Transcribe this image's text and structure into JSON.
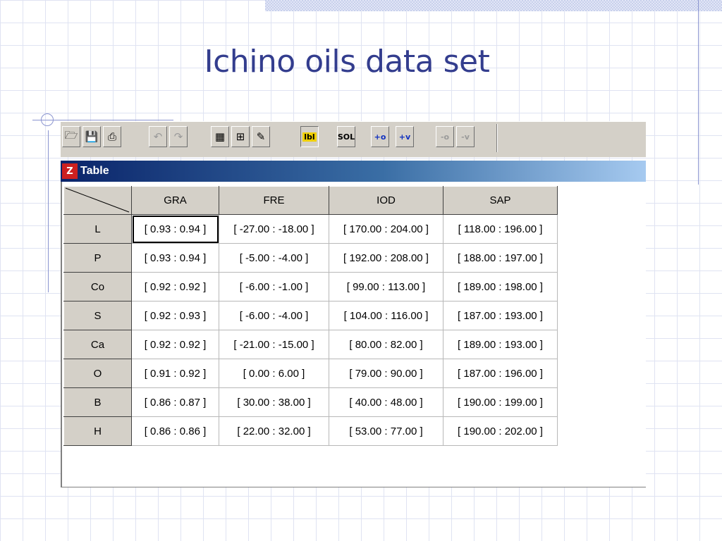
{
  "slide": {
    "title": "Ichino oils data set"
  },
  "toolbar": {
    "buttons": [
      {
        "icon": "open-folder-icon",
        "glyph": "🗁",
        "state": "normal"
      },
      {
        "icon": "save-icon",
        "glyph": "💾",
        "state": "normal"
      },
      {
        "icon": "print-icon",
        "glyph": "⎙",
        "state": "normal"
      },
      {
        "icon": "undo-icon",
        "glyph": "↶",
        "state": "disabled"
      },
      {
        "icon": "redo-icon",
        "glyph": "↷",
        "state": "disabled"
      },
      {
        "icon": "table-icon",
        "glyph": "▦",
        "state": "normal"
      },
      {
        "icon": "grid-icon",
        "glyph": "⊞",
        "state": "normal"
      },
      {
        "icon": "chart-icon",
        "glyph": "✎",
        "state": "normal"
      },
      {
        "icon": "label-icon",
        "label": "lbl",
        "state": "pressed"
      },
      {
        "icon": "sol-icon",
        "label": "SOL",
        "state": "normal"
      },
      {
        "icon": "add-object-icon",
        "label": "+o",
        "state": "normal"
      },
      {
        "icon": "add-variable-icon",
        "label": "+v",
        "state": "normal"
      },
      {
        "icon": "remove-object-icon",
        "label": "-o",
        "state": "disabled"
      },
      {
        "icon": "remove-variable-icon",
        "label": "-v",
        "state": "disabled"
      }
    ]
  },
  "window": {
    "title": "Table"
  },
  "table": {
    "columns": [
      "GRA",
      "FRE",
      "IOD",
      "SAP"
    ],
    "rows": [
      {
        "label": "L",
        "cells": [
          "[ 0.93 : 0.94 ]",
          "[ -27.00 : -18.00 ]",
          "[ 170.00 : 204.00 ]",
          "[ 118.00 : 196.00 ]"
        ]
      },
      {
        "label": "P",
        "cells": [
          "[ 0.93 : 0.94 ]",
          "[ -5.00 : -4.00 ]",
          "[ 192.00 : 208.00 ]",
          "[ 188.00 : 197.00 ]"
        ]
      },
      {
        "label": "Co",
        "cells": [
          "[ 0.92 : 0.92 ]",
          "[ -6.00 : -1.00 ]",
          "[ 99.00 : 113.00 ]",
          "[ 189.00 : 198.00 ]"
        ]
      },
      {
        "label": "S",
        "cells": [
          "[ 0.92 : 0.93 ]",
          "[ -6.00 : -4.00 ]",
          "[ 104.00 : 116.00 ]",
          "[ 187.00 : 193.00 ]"
        ]
      },
      {
        "label": "Ca",
        "cells": [
          "[ 0.92 : 0.92 ]",
          "[ -21.00 : -15.00 ]",
          "[ 80.00 : 82.00 ]",
          "[ 189.00 : 193.00 ]"
        ]
      },
      {
        "label": "O",
        "cells": [
          "[ 0.91 : 0.92 ]",
          "[ 0.00 : 6.00 ]",
          "[ 79.00 : 90.00 ]",
          "[ 187.00 : 196.00 ]"
        ]
      },
      {
        "label": "B",
        "cells": [
          "[ 0.86 : 0.87 ]",
          "[ 30.00 : 38.00 ]",
          "[ 40.00 : 48.00 ]",
          "[ 190.00 : 199.00 ]"
        ]
      },
      {
        "label": "H",
        "cells": [
          "[ 0.86 : 0.86 ]",
          "[ 22.00 : 32.00 ]",
          "[ 53.00 : 77.00 ]",
          "[ 190.00 : 202.00 ]"
        ]
      }
    ]
  },
  "colors": {
    "title": "#333d8e",
    "titlebar_start": "#0a246a",
    "titlebar_end": "#a6caf0",
    "chrome": "#d4d0c8"
  }
}
